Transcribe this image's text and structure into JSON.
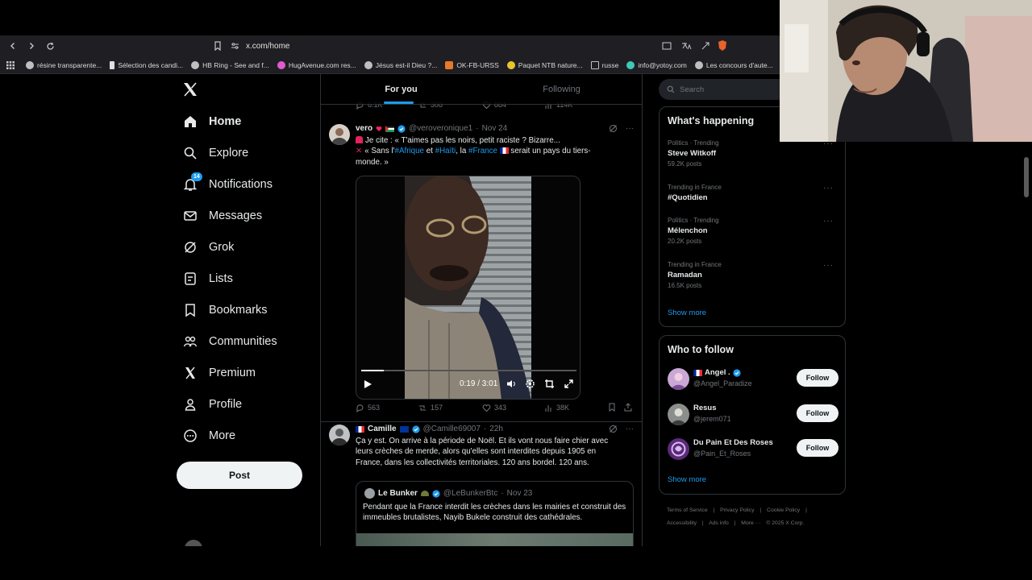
{
  "browser": {
    "url": "x.com/home",
    "bookmarks": [
      {
        "label": "résine transparente...",
        "color": "#bfbfbf"
      },
      {
        "label": "Sélection des candi...",
        "color": "#e0e0e0"
      },
      {
        "label": "HB Ring - See and f...",
        "color": "#bfbfbf"
      },
      {
        "label": "HugAvenue.com res...",
        "color": "#e05ad0"
      },
      {
        "label": "Jésus est-il Dieu ?...",
        "color": "#bfbfbf"
      },
      {
        "label": "OK-FB-URSS",
        "color": "#e8782a"
      },
      {
        "label": "Paquet NTB nature...",
        "color": "#e6c62d"
      },
      {
        "label": "russe",
        "color": "#bfbfbf"
      },
      {
        "label": "info@yotoy.com",
        "color": "#3ec9b8"
      },
      {
        "label": "Les concours d'aute...",
        "color": "#bfbfbf"
      }
    ]
  },
  "nav": {
    "items": [
      {
        "label": "Home",
        "icon": "home-icon"
      },
      {
        "label": "Explore",
        "icon": "search-icon"
      },
      {
        "label": "Notifications",
        "icon": "bell-icon",
        "badge": "14"
      },
      {
        "label": "Messages",
        "icon": "envelope-icon"
      },
      {
        "label": "Grok",
        "icon": "grok-icon"
      },
      {
        "label": "Lists",
        "icon": "list-icon"
      },
      {
        "label": "Bookmarks",
        "icon": "bookmark-icon"
      },
      {
        "label": "Communities",
        "icon": "communities-icon"
      },
      {
        "label": "Premium",
        "icon": "x-icon"
      },
      {
        "label": "Profile",
        "icon": "person-icon"
      },
      {
        "label": "More",
        "icon": "more-circle-icon"
      }
    ],
    "post_label": "Post"
  },
  "feed": {
    "tabs": [
      "For you",
      "Following"
    ],
    "top_stats": {
      "replies": "6.1K",
      "reposts": "308",
      "likes": "884",
      "views": "114K"
    },
    "tweet1": {
      "name": "vero",
      "handle": "@veroveronique1",
      "time": "Nov 24",
      "line1": "Je cite : « T'aimes pas les noirs, petit raciste ? Bizarre...",
      "line2_pre": "« Sans l'",
      "tag1": "#Afrique",
      "line2_mid1": " et ",
      "tag2": "#Haïti",
      "line2_mid2": ", la ",
      "tag3": "#France",
      "line2_post": " serait un pays du tiers-",
      "line3": "monde. »",
      "video_time": "0:19 / 3:01",
      "video_progress": 0.105,
      "stats": {
        "replies": "563",
        "reposts": "157",
        "likes": "343",
        "views": "38K"
      }
    },
    "tweet2": {
      "name": "Camille",
      "handle": "@Camille69007",
      "time": "22h",
      "text": "Ça y est. On arrive à la période de Noël. Et ils vont nous faire chier avec leurs crèches de merde, alors qu'elles sont interdites depuis 1905 en France, dans les collectivités territoriales. 120 ans bordel. 120 ans.",
      "quote": {
        "name": "Le Bunker",
        "handle": "@LeBunkerBtc",
        "time": "Nov 23",
        "text": "Pendant que la France interdit les crèches dans les mairies et construit des immeubles brutalistes, Nayib Bukele construit des cathédrales."
      }
    }
  },
  "right": {
    "search_placeholder": "Search",
    "happening_title": "What's happening",
    "trends": [
      {
        "meta": "Politics · Trending",
        "title": "Steve Witkoff",
        "count": "59.2K posts"
      },
      {
        "meta": "Trending in France",
        "title": "#Quotidien",
        "count": ""
      },
      {
        "meta": "Politics · Trending",
        "title": "Mélenchon",
        "count": "20.2K posts"
      },
      {
        "meta": "Trending in France",
        "title": "Ramadan",
        "count": "16.5K posts"
      }
    ],
    "show_more": "Show more",
    "who_title": "Who to follow",
    "who": [
      {
        "name": "Angel .",
        "handle": "@Angel_Paradize",
        "follow": "Follow"
      },
      {
        "name": "Resus",
        "handle": "@jerem071",
        "follow": "Follow"
      },
      {
        "name": "Du Pain Et Des Roses",
        "handle": "@Pain_Et_Roses",
        "follow": "Follow"
      }
    ],
    "footer": [
      "Terms of Service",
      "|",
      "Privacy Policy",
      "|",
      "Cookie Policy",
      "|",
      "Accessibility",
      "|",
      "Ads info",
      "|",
      "More ···",
      "© 2025 X Corp."
    ]
  }
}
